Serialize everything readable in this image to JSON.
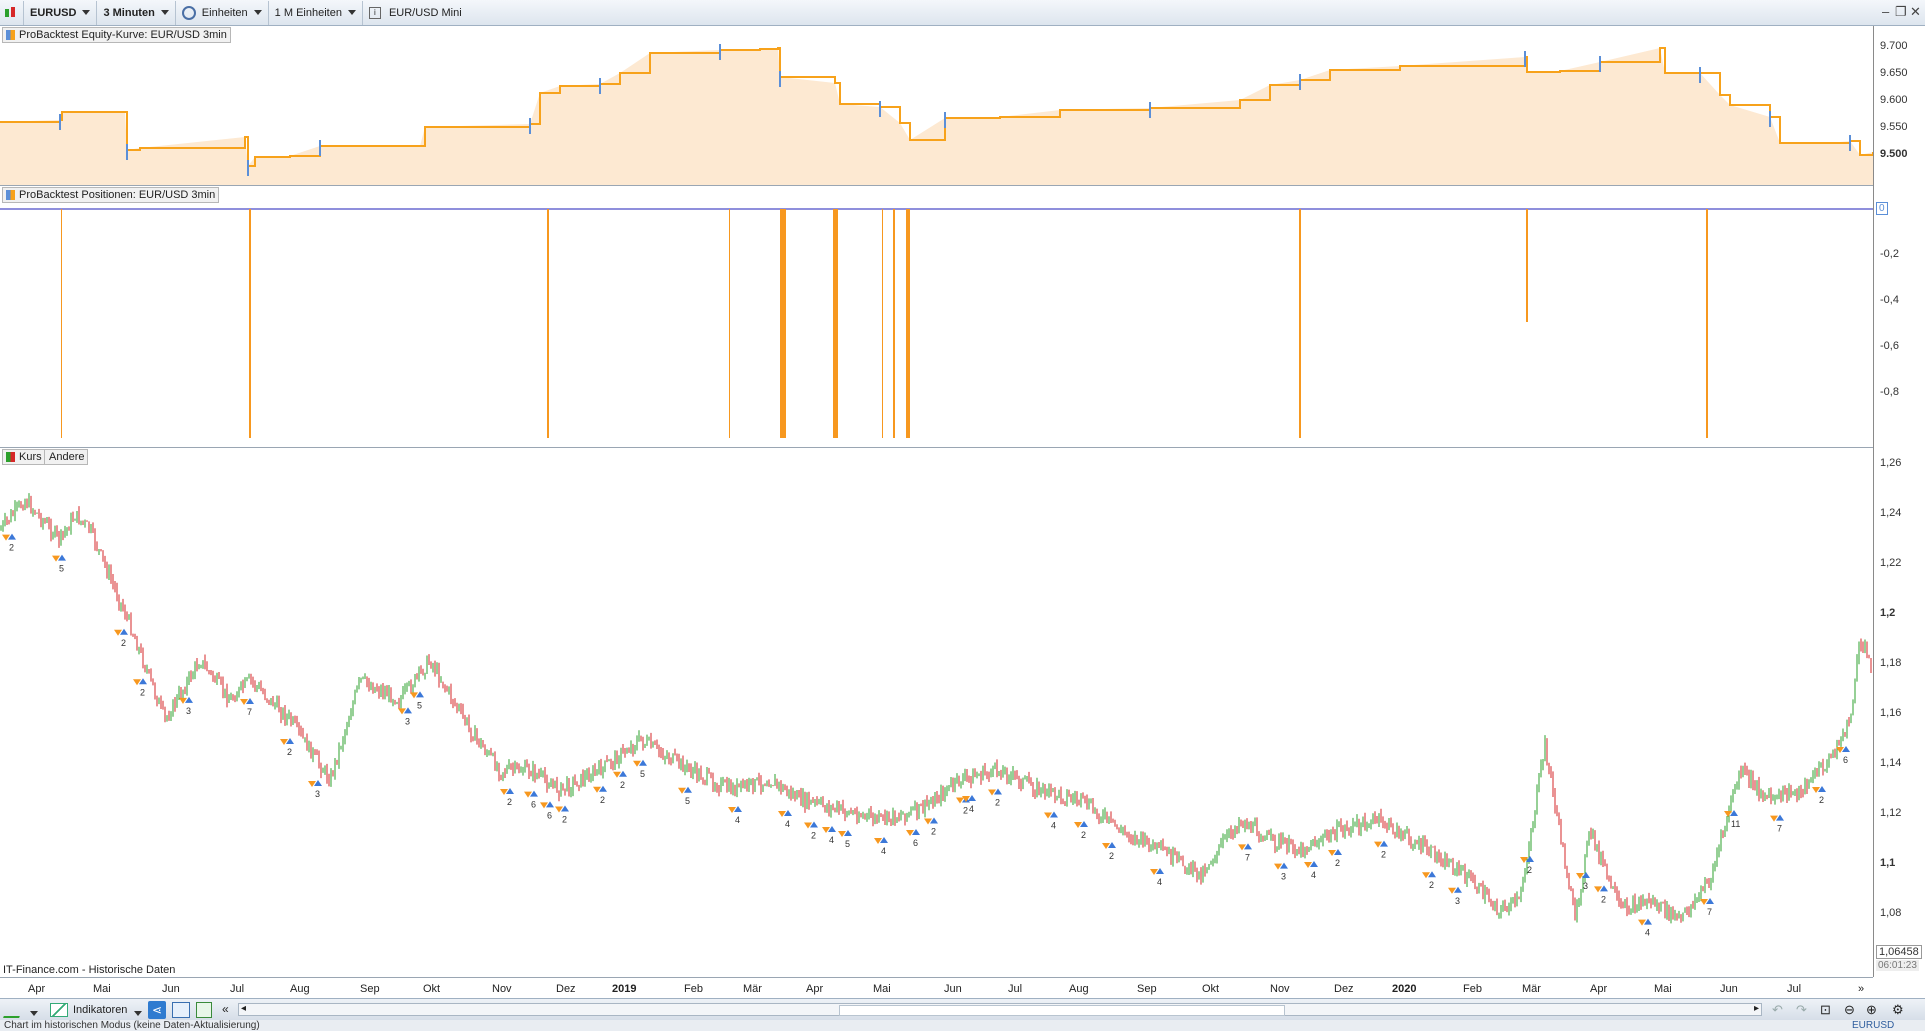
{
  "toolbar": {
    "symbol": "EURUSD",
    "timeframe": "3 Minuten",
    "units_label": "Einheiten",
    "units_count": "1 M Einheiten",
    "instrument_name": "EUR/USD Mini"
  },
  "panels": {
    "equity": {
      "label": "ProBacktest Equity-Kurve: EUR/USD 3min",
      "yticks": [
        "9.700",
        "9.650",
        "9.600",
        "9.550",
        "9.500"
      ],
      "fill_color": "#fde9d2",
      "line_colors": [
        "#f7a21b",
        "#5b8fd8"
      ]
    },
    "positions": {
      "label": "ProBacktest Positionen: EUR/USD 3min",
      "yticks": [
        "0",
        "-0,2",
        "-0,4",
        "-0,6",
        "-0,8"
      ],
      "bar_color": "#f7981f"
    },
    "price": {
      "tag_kurs": "Kurs",
      "tag_andere": "Andere",
      "yticks": [
        "1,26",
        "1,24",
        "1,22",
        "1,2",
        "1,18",
        "1,16",
        "1,14",
        "1,12",
        "1,1",
        "1,08"
      ],
      "current_price": "1,06458",
      "current_time": "06:01:23",
      "source": "IT-Finance.com - Historische Daten",
      "up_color": "#2ca02c",
      "down_color": "#d62728",
      "trade_markers": [
        "2",
        "5",
        "2",
        "2",
        "3",
        "7",
        "2",
        "3",
        "3",
        "5",
        "2",
        "6",
        "6",
        "2",
        "2",
        "2",
        "5",
        "5",
        "4",
        "4",
        "2",
        "4",
        "5",
        "4",
        "6",
        "2",
        "2",
        "4",
        "2",
        "4",
        "2",
        "2",
        "4",
        "7",
        "3",
        "4",
        "2",
        "2",
        "2",
        "3",
        "2",
        "3",
        "2",
        "4",
        "7",
        "11",
        "7",
        "2",
        "6"
      ]
    }
  },
  "xaxis": [
    "Apr",
    "Mai",
    "Jun",
    "Jul",
    "Aug",
    "Sep",
    "Okt",
    "Nov",
    "Dez",
    "2019",
    "Feb",
    "Mär",
    "Apr",
    "Mai",
    "Jun",
    "Jul",
    "Aug",
    "Sep",
    "Okt",
    "Nov",
    "Dez",
    "2020",
    "Feb",
    "Mär",
    "Apr",
    "Mai",
    "Jun",
    "Jul"
  ],
  "statusbar": {
    "indicators_label": "Indikatoren",
    "mode_text": "Chart im historischen Modus (keine Daten-Aktualisierung)",
    "symbol_right": "EURUSD"
  }
}
